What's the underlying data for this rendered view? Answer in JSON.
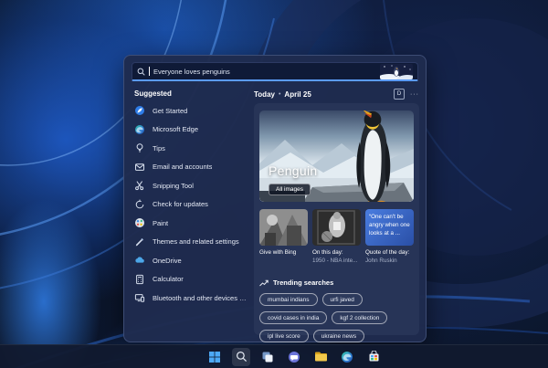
{
  "colors": {
    "accent": "#5b9bf5",
    "panel": "#1f2b4e",
    "panel_inner": "#273457",
    "searchbar": "#0f1a37",
    "quote_card": "#3a63c4",
    "wallpaper_bright": "#2f7de8",
    "wallpaper_dark": "#0a1426"
  },
  "panel": {
    "search": {
      "query": "Everyone loves penguins",
      "icon": "search-icon"
    },
    "suggested": {
      "title": "Suggested",
      "items": [
        {
          "label": "Get Started",
          "icon": "get-started-icon"
        },
        {
          "label": "Microsoft Edge",
          "icon": "edge-icon"
        },
        {
          "label": "Tips",
          "icon": "tips-bulb-icon"
        },
        {
          "label": "Email and accounts",
          "icon": "email-icon"
        },
        {
          "label": "Snipping Tool",
          "icon": "snipping-tool-icon"
        },
        {
          "label": "Check for updates",
          "icon": "updates-sync-icon"
        },
        {
          "label": "Paint",
          "icon": "paint-palette-icon"
        },
        {
          "label": "Themes and related settings",
          "icon": "themes-pencil-icon"
        },
        {
          "label": "OneDrive",
          "icon": "onedrive-cloud-icon"
        },
        {
          "label": "Calculator",
          "icon": "calculator-icon"
        },
        {
          "label": "Bluetooth and other devices sett...",
          "icon": "devices-icon"
        }
      ]
    },
    "today": {
      "label": "Today",
      "separator": "•",
      "date": "April 25",
      "d_badge": "D",
      "more": "···"
    },
    "hero": {
      "title": "Penguin",
      "all_images": "All images"
    },
    "cards": [
      {
        "caption": "Give with Bing"
      },
      {
        "caption_top": "On this day:",
        "caption_bottom": "1950 - NBA inte..."
      },
      {
        "quote": "“One can't be angry when one looks at a ...",
        "caption_top": "Quote of the day:",
        "caption_bottom": "John Ruskin"
      }
    ],
    "trending": {
      "title": "Trending searches",
      "chips": [
        "mumbai indians",
        "urfi javed",
        "covid cases in india",
        "kgf 2 collection",
        "ipl live score",
        "ukraine news"
      ]
    }
  },
  "taskbar": {
    "icons": [
      "start",
      "search",
      "task-view",
      "chat",
      "file-explorer",
      "edge",
      "store"
    ]
  }
}
